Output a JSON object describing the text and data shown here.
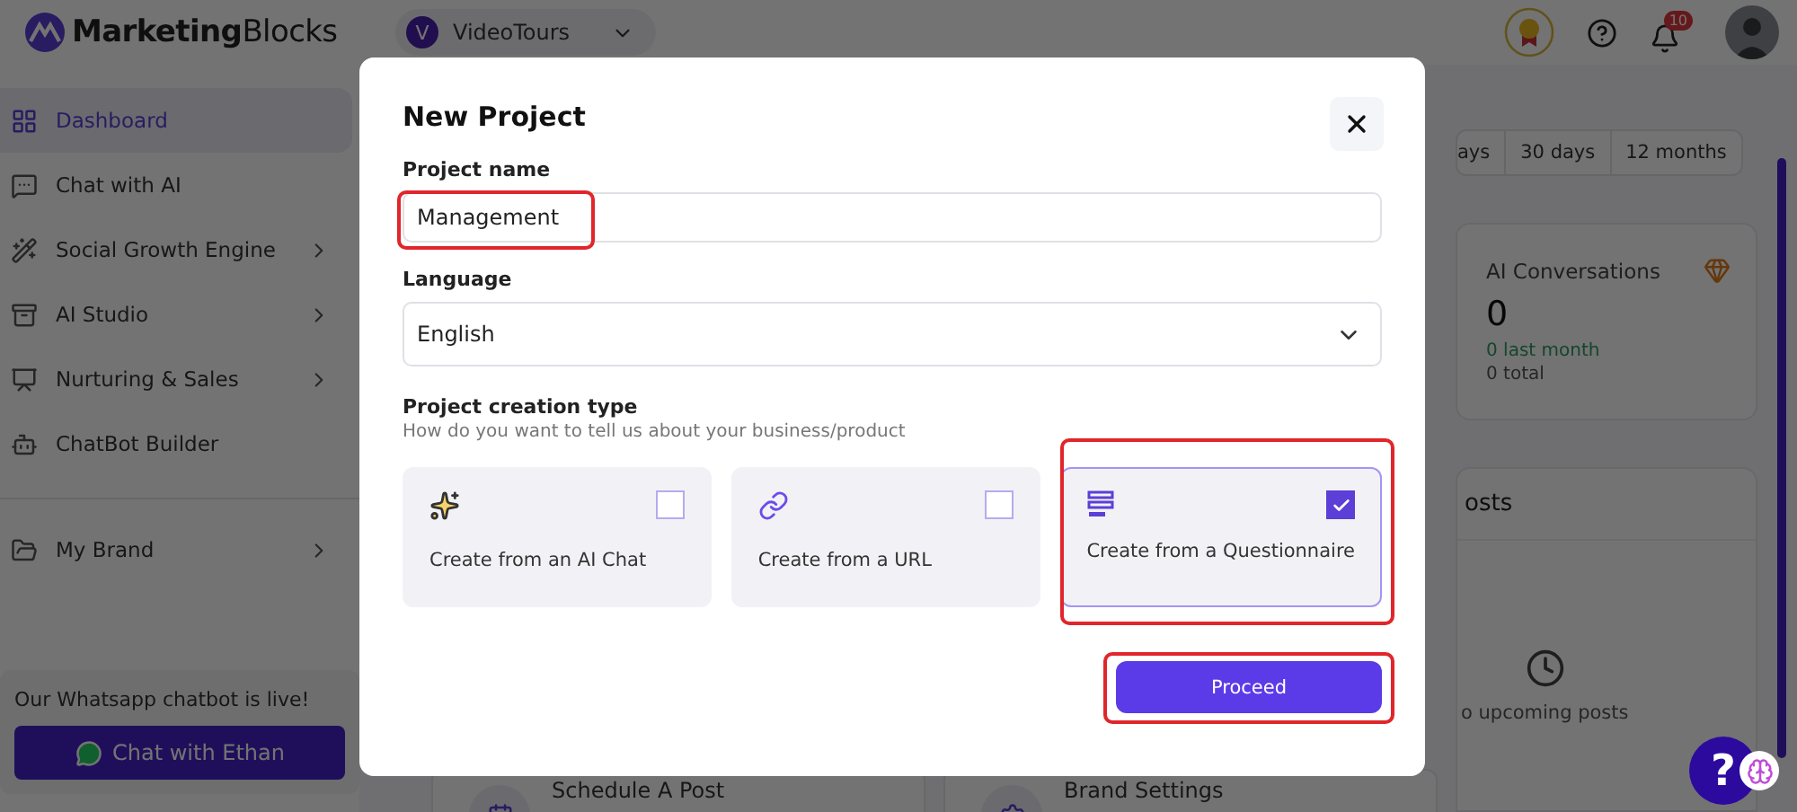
{
  "header": {
    "logo": "**Marketing**Blocks",
    "project": {
      "initial": "V",
      "name": "VideoTours"
    },
    "notifications": "10"
  },
  "sidebar": {
    "items": [
      {
        "label": "Dashboard",
        "selected": true,
        "has_submenu": false
      },
      {
        "label": "Chat with AI",
        "selected": false,
        "has_submenu": false
      },
      {
        "label": "Social Growth Engine",
        "selected": false,
        "has_submenu": true
      },
      {
        "label": "AI Studio",
        "selected": false,
        "has_submenu": true
      },
      {
        "label": "Nurturing & Sales",
        "selected": false,
        "has_submenu": true
      },
      {
        "label": "ChatBot Builder",
        "selected": false,
        "has_submenu": false
      },
      {
        "label": "My Brand",
        "selected": false,
        "has_submenu": true
      }
    ],
    "promo": {
      "text": "Our Whatsapp chatbot is live!",
      "button": "Chat with Ethan"
    }
  },
  "dashboard": {
    "ranges": [
      "ays",
      "30 days",
      "12 months"
    ],
    "stat": {
      "title": "AI Conversations",
      "value": "0",
      "change": "0 last month",
      "total": "0 total"
    },
    "posts": {
      "title": "osts",
      "empty": "o upcoming posts"
    },
    "quick_actions": [
      "Schedule A Post",
      "Brand Settings"
    ],
    "help_button": "?"
  },
  "modal": {
    "title": "New Project",
    "fields": [
      {
        "kind": "text",
        "label": "Project name",
        "value": "Management",
        "highlighted": true
      },
      {
        "kind": "select",
        "label": "Language",
        "value": "English"
      }
    ],
    "creation_type": {
      "label": "Project creation type",
      "hint": "How do you want to tell us about your business/product",
      "highlighted": true,
      "options": [
        {
          "label": "Create from an AI Chat",
          "selected": false
        },
        {
          "label": "Create from a URL",
          "selected": false
        },
        {
          "label": "Create from a Questionnaire",
          "selected": true
        }
      ]
    },
    "proceed": {
      "label": "Proceed",
      "highlighted": true
    }
  }
}
